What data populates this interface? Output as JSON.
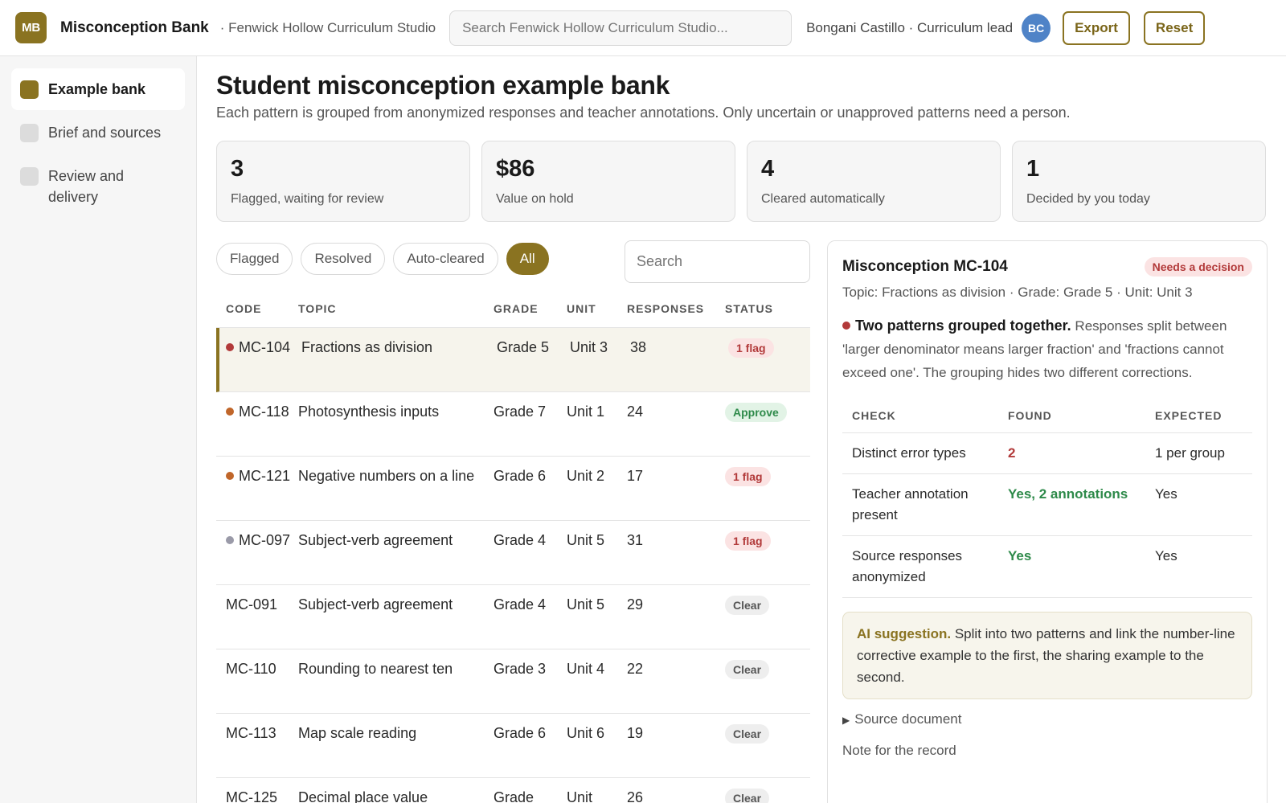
{
  "header": {
    "logo": "MB",
    "app_title": "Misconception Bank",
    "workspace": "· Fenwick Hollow Curriculum Studio",
    "search_placeholder": "Search Fenwick Hollow Curriculum Studio...",
    "user": "Bongani Castillo · Curriculum lead",
    "avatar": "BC",
    "export_label": "Export",
    "reset_label": "Reset"
  },
  "sidebar": {
    "items": [
      {
        "label": "Example bank",
        "active": true
      },
      {
        "label": "Brief and sources",
        "active": false
      },
      {
        "label": "Review and delivery",
        "active": false
      }
    ]
  },
  "main": {
    "title": "Student misconception example bank",
    "subtitle": "Each pattern is grouped from anonymized responses and teacher annotations. Only uncertain or unapproved patterns need a person.",
    "stats": [
      {
        "value": "3",
        "label": "Flagged, waiting for review"
      },
      {
        "value": "$86",
        "label": "Value on hold"
      },
      {
        "value": "4",
        "label": "Cleared automatically"
      },
      {
        "value": "1",
        "label": "Decided by you today"
      }
    ],
    "filters": [
      "Flagged",
      "Resolved",
      "Auto-cleared",
      "All"
    ],
    "active_filter": "All",
    "table_search_placeholder": "Search"
  },
  "table": {
    "headers": [
      "CODE",
      "TOPIC",
      "GRADE",
      "UNIT",
      "RESPONSES",
      "STATUS"
    ],
    "rows": [
      {
        "code": "MC-104",
        "dot": "#b23a3a",
        "topic": "Fractions as division",
        "grade": "Grade 5",
        "unit": "Unit 3",
        "responses": "38",
        "status": "1 flag",
        "status_kind": "flag",
        "selected": true
      },
      {
        "code": "MC-118",
        "dot": "#c0662a",
        "topic": "Photosynthesis inputs",
        "grade": "Grade 7",
        "unit": "Unit 1",
        "responses": "24",
        "status": "Approve",
        "status_kind": "approve",
        "selected": false
      },
      {
        "code": "MC-121",
        "dot": "#c0662a",
        "topic": "Negative numbers on a line",
        "grade": "Grade 6",
        "unit": "Unit 2",
        "responses": "17",
        "status": "1 flag",
        "status_kind": "flag",
        "selected": false
      },
      {
        "code": "MC-097",
        "dot": "#9a9aa8",
        "topic": "Subject-verb agreement",
        "grade": "Grade 4",
        "unit": "Unit 5",
        "responses": "31",
        "status": "1 flag",
        "status_kind": "flag",
        "selected": false
      },
      {
        "code": "MC-091",
        "dot": "",
        "topic": "Subject-verb agreement",
        "grade": "Grade 4",
        "unit": "Unit 5",
        "responses": "29",
        "status": "Clear",
        "status_kind": "clear",
        "selected": false
      },
      {
        "code": "MC-110",
        "dot": "",
        "topic": "Rounding to nearest ten",
        "grade": "Grade 3",
        "unit": "Unit 4",
        "responses": "22",
        "status": "Clear",
        "status_kind": "clear",
        "selected": false
      },
      {
        "code": "MC-113",
        "dot": "",
        "topic": "Map scale reading",
        "grade": "Grade 6",
        "unit": "Unit 6",
        "responses": "19",
        "status": "Clear",
        "status_kind": "clear",
        "selected": false
      },
      {
        "code": "MC-125",
        "dot": "",
        "topic": "Decimal place value",
        "grade": "Grade",
        "unit": "Unit",
        "responses": "26",
        "status": "Clear",
        "status_kind": "clear",
        "selected": false
      }
    ]
  },
  "detail": {
    "title": "Misconception MC-104",
    "badge": "Needs a decision",
    "meta": "Topic: Fractions as division · Grade: Grade 5 · Unit: Unit 3",
    "summary_title": "Two patterns grouped together.",
    "summary_text": " Responses split between 'larger denominator means larger fraction' and 'fractions cannot exceed one'. The grouping hides two different corrections.",
    "check_headers": [
      "CHECK",
      "FOUND",
      "EXPECTED"
    ],
    "checks": [
      {
        "check": "Distinct error types",
        "found": "2",
        "found_kind": "red",
        "expected": "1 per group"
      },
      {
        "check": "Teacher annotation present",
        "found": "Yes, 2 annotations",
        "found_kind": "green",
        "expected": "Yes"
      },
      {
        "check": "Source responses anonymized",
        "found": "Yes",
        "found_kind": "green",
        "expected": "Yes"
      }
    ],
    "ai_label": "AI suggestion.",
    "ai_text": " Split into two patterns and link the number-line corrective example to the first, the sharing example to the second.",
    "source_toggle": "Source document",
    "note_label": "Note for the record"
  }
}
